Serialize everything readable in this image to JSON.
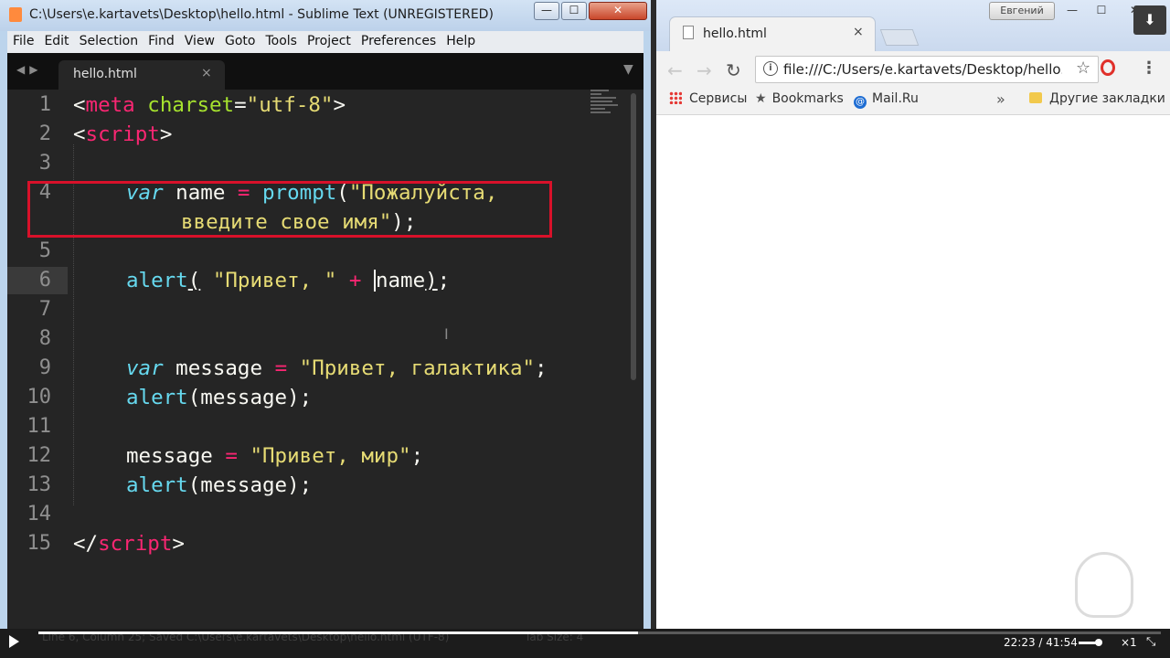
{
  "sublime": {
    "title": "C:\\Users\\e.kartavets\\Desktop\\hello.html - Sublime Text (UNREGISTERED)",
    "menu": [
      "File",
      "Edit",
      "Selection",
      "Find",
      "View",
      "Goto",
      "Tools",
      "Project",
      "Preferences",
      "Help"
    ],
    "tab_label": "hello.html",
    "tab_close": "×",
    "line_numbers": [
      "1",
      "2",
      "3",
      "4",
      "",
      "5",
      "6",
      "7",
      "8",
      "9",
      "10",
      "11",
      "12",
      "13",
      "14",
      "15"
    ],
    "code": {
      "l1_open": "<",
      "l1_tag": "meta",
      "l1_attr": " charset",
      "l1_eq": "=",
      "l1_val": "\"utf-8\"",
      "l1_close": ">",
      "l2_open": "<",
      "l2_tag": "script",
      "l2_close": ">",
      "l4_kw": "var",
      "l4_name": " name ",
      "l4_eq": "=",
      "l4_fn": " prompt",
      "l4_paren": "(",
      "l4_str": "\"Пожалуйста,",
      "l4b_str": "введите свое имя\"",
      "l4b_end": ");",
      "l6_fn": "alert",
      "l6_paren": "(",
      "l6_sp": " ",
      "l6_str": "\"Привет, \"",
      "l6_plus": " + ",
      "l6_name": "name",
      "l6_close": ")",
      "l6_semi": ";",
      "l9_kw": "var",
      "l9_name": " message ",
      "l9_eq": "=",
      "l9_str": " \"Привет, галактика\"",
      "l9_semi": ";",
      "l10_fn": "alert",
      "l10_rest": "(message);",
      "l12_name": "message ",
      "l12_eq": "=",
      "l12_str": " \"Привет, мир\"",
      "l12_semi": ";",
      "l13_fn": "alert",
      "l13_rest": "(message);",
      "l15_open": "</",
      "l15_tag": "script",
      "l15_close": ">"
    },
    "status": "Line 6, Column 25; Saved C:\\Users\\e.kartavets\\Desktop\\hello.html (UTF-8)",
    "tab_size": "Tab Size: 4"
  },
  "chrome": {
    "tab_title": "hello.html",
    "tab_close": "×",
    "profile": "Евгений",
    "url": "file:///C:/Users/e.kartavets/Desktop/hello.html",
    "bookmarks": [
      "Сервисы",
      "Bookmarks",
      "Mail.Ru"
    ],
    "bookmarks_more": "»",
    "other_bookmarks": "Другие закладки"
  },
  "player": {
    "time": "22:23 / 41:54",
    "speed": "×1",
    "progress": 0.534
  },
  "colors": {
    "highlight_box": "#d8112a",
    "keyword": "#66d9ef",
    "tag": "#f92672",
    "string": "#e6db74",
    "attribute": "#a6e22e"
  }
}
